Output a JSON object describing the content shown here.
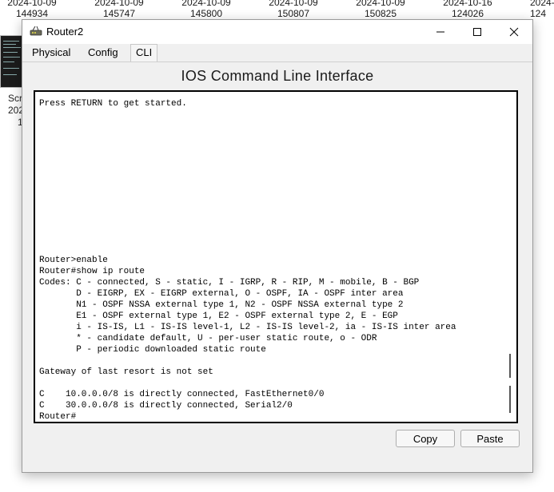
{
  "desktop": {
    "files": [
      {
        "date": "2024-10-09",
        "time": "144934"
      },
      {
        "date": "2024-10-09",
        "time": "145747"
      },
      {
        "date": "2024-10-09",
        "time": "145800"
      },
      {
        "date": "2024-10-09",
        "time": "150807"
      },
      {
        "date": "2024-10-09",
        "time": "150825"
      },
      {
        "date": "2024-10-16",
        "time": "124026"
      },
      {
        "date": "2024-",
        "time": "124"
      }
    ],
    "side_label_1": "Scr",
    "side_label_2": "202",
    "side_label_3": "1"
  },
  "window": {
    "title": "Router2",
    "app_icon": "router-icon",
    "controls": {
      "minimize": "minimize-icon",
      "maximize": "maximize-icon",
      "close": "close-icon"
    },
    "tabs": [
      "Physical",
      "Config",
      "CLI"
    ],
    "active_tab": "CLI",
    "heading": "IOS Command Line Interface",
    "cli_output": "Press RETURN to get started.\n\n\n\n\n\n\n\n\n\n\n\n\n\nRouter>enable\nRouter#show ip route\nCodes: C - connected, S - static, I - IGRP, R - RIP, M - mobile, B - BGP\n       D - EIGRP, EX - EIGRP external, O - OSPF, IA - OSPF inter area\n       N1 - OSPF NSSA external type 1, N2 - OSPF NSSA external type 2\n       E1 - OSPF external type 1, E2 - OSPF external type 2, E - EGP\n       i - IS-IS, L1 - IS-IS level-1, L2 - IS-IS level-2, ia - IS-IS inter area\n       * - candidate default, U - per-user static route, o - ODR\n       P - periodic downloaded static route\n\nGateway of last resort is not set\n\nC    10.0.0.0/8 is directly connected, FastEthernet0/0\nC    30.0.0.0/8 is directly connected, Serial2/0\nRouter#",
    "buttons": {
      "copy": "Copy",
      "paste": "Paste"
    }
  }
}
